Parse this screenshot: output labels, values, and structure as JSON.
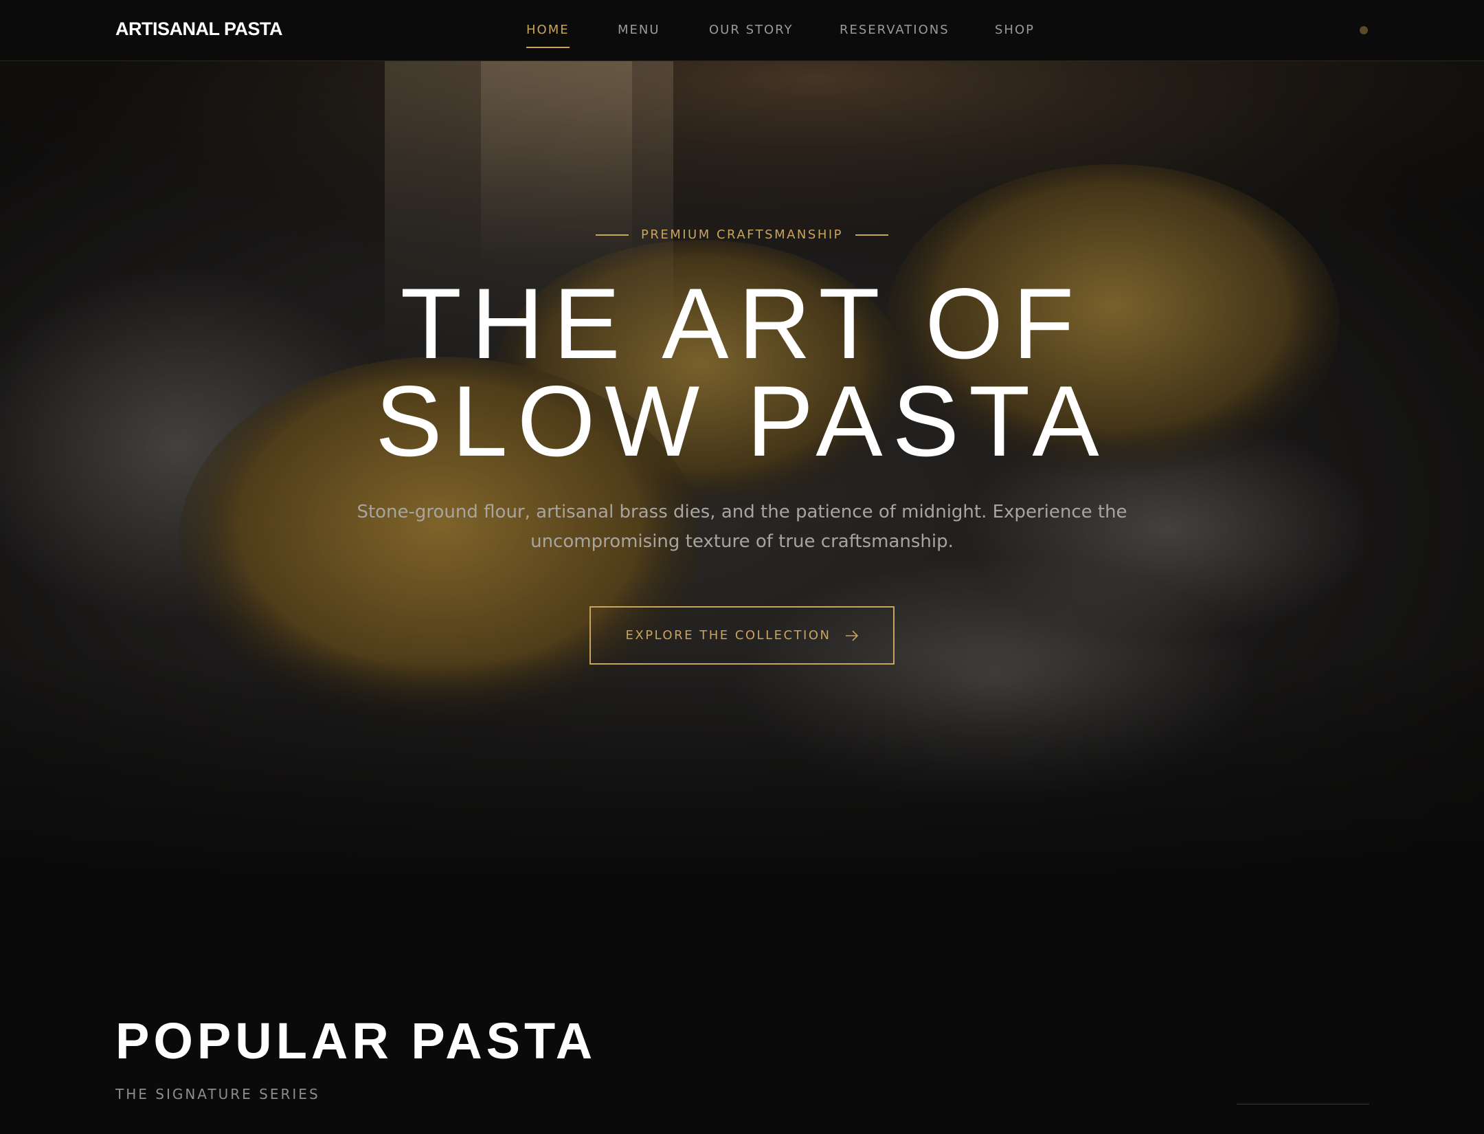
{
  "brand": {
    "name": "ARTISANAL PASTA"
  },
  "nav": {
    "items": [
      {
        "label": "HOME",
        "active": true
      },
      {
        "label": "MENU",
        "active": false
      },
      {
        "label": "OUR STORY",
        "active": false
      },
      {
        "label": "RESERVATIONS",
        "active": false
      },
      {
        "label": "SHOP",
        "active": false
      }
    ]
  },
  "hero": {
    "eyebrow": "PREMIUM CRAFTSMANSHIP",
    "title_line1": "THE ART OF",
    "title_line2": "SLOW PASTA",
    "subtitle": "Stone-ground flour, artisanal brass dies, and the patience of midnight. Experience the uncompromising texture of true craftsmanship.",
    "cta_label": "EXPLORE THE COLLECTION",
    "cta_icon": "arrow-right-icon"
  },
  "popular": {
    "title": "POPULAR PASTA",
    "subtitle": "THE SIGNATURE SERIES"
  },
  "colors": {
    "accent": "#c9a45c",
    "background": "#0a0a0a",
    "text": "#ffffff",
    "muted": "#9a9a9a"
  }
}
